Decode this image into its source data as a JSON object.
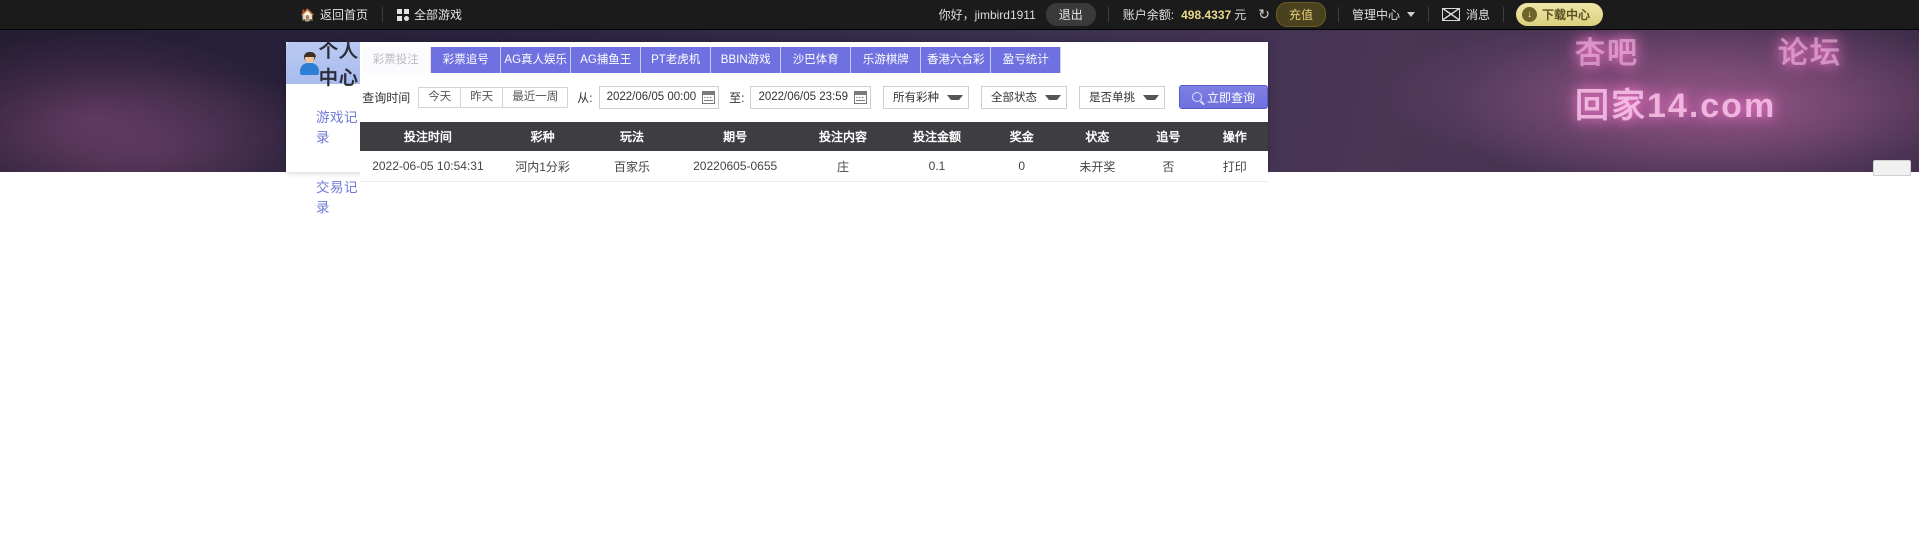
{
  "topbar": {
    "home_label": "返回首页",
    "home_icon": "home-icon",
    "all_games_label": "全部游戏",
    "all_games_icon": "grid-icon",
    "greeting": "你好，jimbird1911",
    "logout_label": "退出",
    "balance_label": "账户余额:",
    "balance_value": "498.4337",
    "balance_unit": "元",
    "refresh_icon": "refresh-icon",
    "recharge_label": "充值",
    "admin_label": "管理中心",
    "admin_caret_icon": "chevron-down-icon",
    "message_icon": "envelope-icon",
    "message_label": "消息",
    "download_label": "下载中心",
    "download_icon": "download-circle-icon"
  },
  "watermark": {
    "line1_left": "杏吧",
    "line1_right": "论坛",
    "line2": "回家14.com"
  },
  "sidebar": {
    "title": "个人中心",
    "avatar_icon": "user-avatar-icon",
    "items": [
      {
        "label": "游戏记录"
      },
      {
        "label": "交易记录"
      }
    ]
  },
  "tabs": [
    {
      "label": "彩票投注",
      "active": true
    },
    {
      "label": "彩票追号",
      "active": false
    },
    {
      "label": "AG真人娱乐",
      "active": false
    },
    {
      "label": "AG捕鱼王",
      "active": false
    },
    {
      "label": "PT老虎机",
      "active": false
    },
    {
      "label": "BBIN游戏",
      "active": false
    },
    {
      "label": "沙巴体育",
      "active": false
    },
    {
      "label": "乐游棋牌",
      "active": false
    },
    {
      "label": "香港六合彩",
      "active": false
    },
    {
      "label": "盈亏统计",
      "active": false
    }
  ],
  "filters": {
    "time_label": "查询时间",
    "quick_buttons": [
      "今天",
      "昨天",
      "最近一周"
    ],
    "from_label": "从:",
    "from_value": "2022/06/05 00:00",
    "to_label": "至:",
    "to_value": "2022/06/05 23:59",
    "calendar_icon": "calendar-icon",
    "lottery_select": "所有彩种",
    "status_select": "全部状态",
    "single_select": "是否单挑",
    "search_icon": "search-icon",
    "search_button": "立即查询"
  },
  "table": {
    "columns": [
      "投注时间",
      "彩种",
      "玩法",
      "期号",
      "投注内容",
      "投注金额",
      "奖金",
      "状态",
      "追号",
      "操作"
    ],
    "rows": [
      {
        "time": "2022-06-05 10:54:31",
        "lottery": "河内1分彩",
        "play": "百家乐",
        "issue": "20220605-0655",
        "content": "庄",
        "amount": "0.1",
        "prize": "0",
        "status": "未开奖",
        "chase": "否",
        "action": "打印"
      }
    ]
  },
  "colors": {
    "tab_active_bg": "#fbfbfd",
    "tab_bg": "#6f71e0",
    "table_header_bg": "#3e3e42",
    "accent": "#6f71e0",
    "balance_gold": "#e8d98a"
  }
}
